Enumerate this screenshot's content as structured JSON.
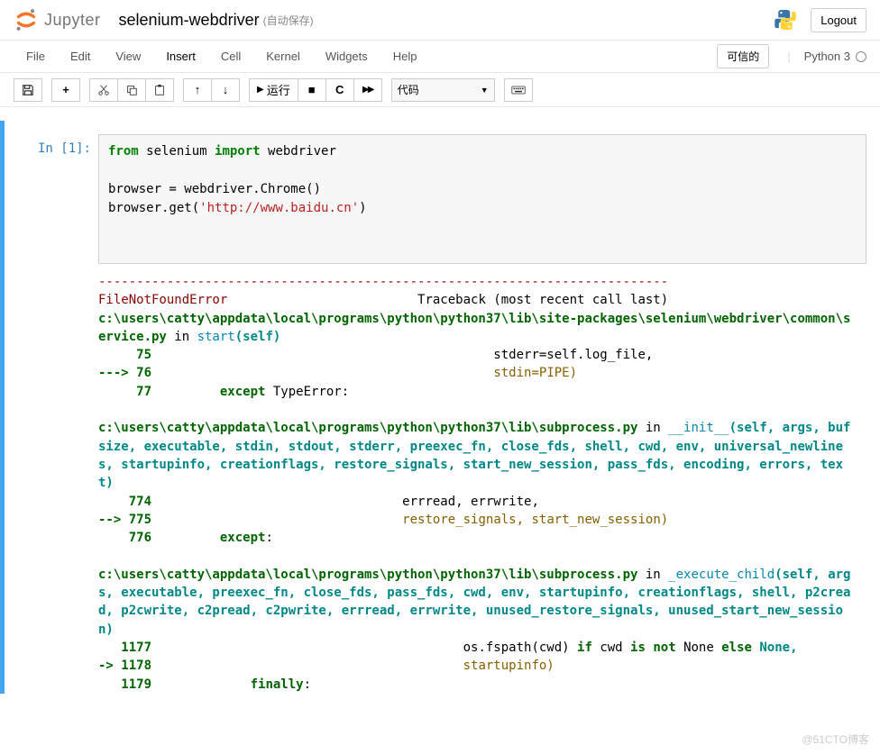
{
  "header": {
    "logo_text": "Jupyter",
    "notebook_title": "selenium-webdriver",
    "autosave_text": "(自动保存)",
    "logout_label": "Logout"
  },
  "menubar": {
    "items": [
      "File",
      "Edit",
      "View",
      "Insert",
      "Cell",
      "Kernel",
      "Widgets",
      "Help"
    ],
    "active_index": 3,
    "trusted_label": "可信的",
    "kernel_name": "Python 3"
  },
  "toolbar": {
    "save_icon": "💾",
    "add_icon": "+",
    "cut_icon": "✂",
    "copy_icon": "⎘",
    "paste_icon": "📋",
    "up_icon": "↑",
    "down_icon": "↓",
    "run_icon": "▶",
    "run_label": "运行",
    "stop_icon": "■",
    "restart_icon": "↻",
    "ff_icon": "▶▶",
    "cell_type": "代码",
    "keyboard_icon": "⌨"
  },
  "cell": {
    "prompt": "In  [1]:",
    "code": {
      "l1_from": "from",
      "l1_mod": " selenium ",
      "l1_import": "import",
      "l1_name": " webdriver",
      "l3": "browser = webdriver.Chrome()",
      "l4a": "browser.get(",
      "l4b": "'http://www.baidu.cn'",
      "l4c": ")"
    }
  },
  "traceback": {
    "sep": "---------------------------------------------------------------------------",
    "err_name": "FileNotFoundError",
    "err_right": "Traceback (most recent call last)",
    "f1_path": "c:\\users\\catty\\appdata\\local\\programs\\python\\python37\\lib\\site-packages\\selenium\\webdriver\\common\\service.py",
    "f1_in": " in ",
    "f1_fn": "start",
    "f1_args": "(self)",
    "f1_l75_num": "     75",
    "f1_l75_code": "                                             stderr=self.log_file,",
    "f1_l76_arrow": "---> ",
    "f1_l76_num": "76",
    "f1_l76_pad": "                                             ",
    "f1_l76_code": "stdin=PIPE)",
    "f1_l77_num": "     77",
    "f1_l77_pad": "         ",
    "f1_l77_kw": "except",
    "f1_l77_code": " TypeError:",
    "f2_path": "c:\\users\\catty\\appdata\\local\\programs\\python\\python37\\lib\\subprocess.py",
    "f2_in": " in ",
    "f2_fn": "__init__",
    "f2_args": "(self, args, bufsize, executable, stdin, stdout, stderr, preexec_fn, close_fds, shell, cwd, env, universal_newlines, startupinfo, creationflags, restore_signals, start_new_session, pass_fds, encoding, errors, text)",
    "f2_l774_num": "    774",
    "f2_l774_code": "                                 errread, errwrite,",
    "f2_l775_arrow": "--> ",
    "f2_l775_num": "775",
    "f2_l775_pad": "                                 ",
    "f2_l775_code": "restore_signals, start_new_session)",
    "f2_l776_num": "    776",
    "f2_l776_pad": "         ",
    "f2_l776_kw": "except",
    "f2_l776_code": ":",
    "f3_path": "c:\\users\\catty\\appdata\\local\\programs\\python\\python37\\lib\\subprocess.py",
    "f3_in": " in ",
    "f3_fn": "_execute_child",
    "f3_args": "(self, args, executable, preexec_fn, close_fds, pass_fds, cwd, env, startupinfo, creationflags, shell, p2cread, p2cwrite, c2pread, c2pwrite, errread, errwrite, unused_restore_signals, unused_start_new_session)",
    "f3_l1177_num": "   1177",
    "f3_l1177_pad": "                                         ",
    "f3_l1177_a": "os.fspath(cwd) ",
    "f3_l1177_if": "if",
    "f3_l1177_b": " cwd ",
    "f3_l1177_is": "is",
    "f3_l1177_c": " ",
    "f3_l1177_not": "not",
    "f3_l1177_d": " None ",
    "f3_l1177_else": "els",
    "f3_l1177_wrap": "e",
    "f3_l1177_none": " None,",
    "f3_l1178_arrow": "-> ",
    "f3_l1178_num": "1178",
    "f3_l1178_pad": "                                         ",
    "f3_l1178_code": "startupinfo)",
    "f3_l1179_num": "   1179",
    "f3_l1179_pad": "             ",
    "f3_l1179_kw": "finally",
    "f3_l1179_code": ":"
  },
  "watermark": "@51CTO博客"
}
